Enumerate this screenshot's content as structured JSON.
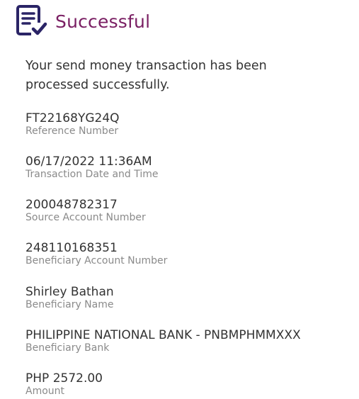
{
  "header": {
    "title": "Successful",
    "icon": "document-check-icon",
    "accent_color": "#7a1f63",
    "icon_color": "#2a2466"
  },
  "message": "Your send money transaction has been processed successfully.",
  "details": [
    {
      "value": "FT22168YG24Q",
      "label": "Reference Number"
    },
    {
      "value": "06/17/2022 11:36AM",
      "label": "Transaction Date and Time"
    },
    {
      "value": "200048782317",
      "label": "Source Account Number"
    },
    {
      "value": "248110168351",
      "label": "Beneficiary Account Number"
    },
    {
      "value": "Shirley Bathan",
      "label": "Beneficiary Name"
    },
    {
      "value": "PHILIPPINE NATIONAL BANK - PNBMPHMMXXX",
      "label": "Beneficiary Bank"
    },
    {
      "value": "PHP 2572.00",
      "label": "Amount"
    }
  ]
}
